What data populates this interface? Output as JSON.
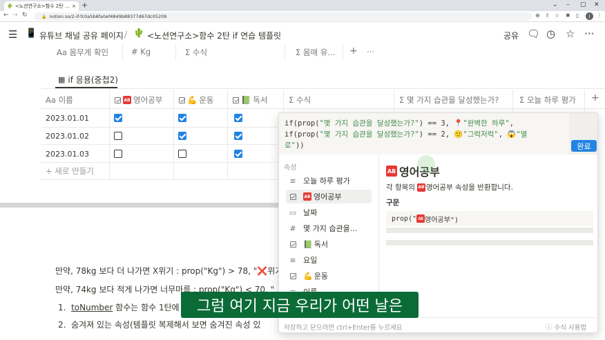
{
  "browser": {
    "tab_title": "<노션연구소>함수 2탄 if 연습",
    "url": "notion.so/2-if-fc0a5b6fa0ef4849b88377d67dc05209",
    "avatar_letter": "J"
  },
  "header": {
    "breadcrumb_1": "유튜브 채널 공유 페이지",
    "separator": "/",
    "breadcrumb_2": "<노션연구소>함수 2탄 if 연습 템플릿",
    "share_label": "공유"
  },
  "top_table": {
    "headers": [
      "Aa 몸무게 확인",
      "# Kg",
      "Σ 수식",
      "Σ 몸매 유..."
    ],
    "add": "+",
    "more": "···"
  },
  "view_tab": {
    "icon": "table-icon",
    "label": "if 응용(중첩2)"
  },
  "table": {
    "headers": {
      "name": "이름",
      "english": "영어공부",
      "exercise": "운동",
      "reading": "독서",
      "formula": "수식",
      "habits": "몇 가지 습관을 달성했는가?",
      "eval": "오늘 하루 평가"
    },
    "rows": [
      {
        "date": "2023.01.01",
        "english": true,
        "exercise": true,
        "reading": true
      },
      {
        "date": "2023.01.02",
        "english": false,
        "exercise": true,
        "reading": true
      },
      {
        "date": "2023.01.03",
        "english": false,
        "exercise": false,
        "reading": true
      }
    ],
    "new_row": "새로 만들기"
  },
  "body": {
    "line1_a": "만약, 78kg 보다 더 나가면 X위기 : prop(\"Kg\") > 78, \"",
    "line1_b": "위기",
    "line2": "만약, 74kg 보다 적게 나가면 너무마름 : prop(\"Kg\") < 70, \"",
    "item1_num": "1.",
    "item1_bold": "toNumber",
    "item1_rest": " 함수는 함수 1탄에",
    "item2_num": "2.",
    "item2_text": "숨겨져 있는 속성(템플릿 복제해서 보면 숨겨진 속성 있"
  },
  "formula": {
    "line1_a": "if(prop(",
    "line1_s1": "\"몇 가지 습관을 달성했는가?\"",
    "line1_b": ") == 3, ",
    "line1_s2": "\"완벽한 하루\"",
    "line1_c": ",",
    "line2_a": "if(prop(",
    "line2_s1": "\"몇 가지 습관을 달성했는가?\"",
    "line2_b": ") == 2, ",
    "line2_s2": "\"그럭저럭\"",
    "line2_c": ", ",
    "line2_s3": "\"멸",
    "line3_s": "로\"",
    "line3_b": "))",
    "done_label": "완료",
    "props_label": "속성",
    "props": [
      {
        "icon": "list-icon",
        "label": "오늘 하루 평가"
      },
      {
        "icon": "checkbox-icon",
        "label": "영어공부"
      },
      {
        "icon": "calendar-icon",
        "label": "날짜"
      },
      {
        "icon": "number-icon",
        "label": "몇 가지 습관을..."
      },
      {
        "icon": "checkbox-icon",
        "label": "독서"
      },
      {
        "icon": "list-icon",
        "label": "요일"
      },
      {
        "icon": "checkbox-icon",
        "label": "운동"
      },
      {
        "icon": "list-icon",
        "label": "이름"
      }
    ],
    "detail_title": "영어공부",
    "detail_desc_a": "각 항목의",
    "detail_desc_b": "영어공부 속성을 반환합니다.",
    "syntax_label": "구문",
    "syntax_code_a": "prop(\"",
    "syntax_code_b": "영어공부\")",
    "footer_hint": "저장하고 닫으려면 ctrl+Enter를 누르세요",
    "footer_help": "수식 사용법"
  },
  "tag_text": "AB",
  "subtitle": "그럼 여기 지금 우리가 어떤 날은",
  "colors": {
    "accent": "#2383e2",
    "subtitle_bg": "#0b6b37",
    "tag": "#e53935"
  }
}
